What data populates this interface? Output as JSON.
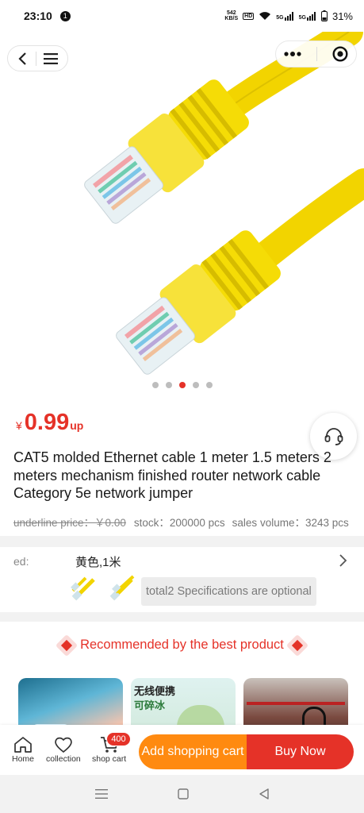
{
  "status_bar": {
    "time": "23:10",
    "notification_count": "1",
    "net_speed_top": "542",
    "net_speed_bottom": "KB/S",
    "hd_label": "HD",
    "signal1": "5G",
    "signal2": "5G",
    "battery": "31%"
  },
  "gallery": {
    "dot_count": 5,
    "active_dot": 3
  },
  "product": {
    "currency": "¥",
    "price": "0.99",
    "price_suffix": "up",
    "title": "CAT5 molded Ethernet cable 1 meter 1.5 meters 2 meters mechanism finished router network cable Category 5e network jumper",
    "underline_price": "underline price：￥0.00",
    "stock": "stock：200000 pcs",
    "sales": "sales volume：3243 pcs"
  },
  "spec": {
    "label": "ed:",
    "value": "黄色,1米",
    "optional_text": "total2 Specifications are optional"
  },
  "recommend": {
    "heading": "Recommended by the best product",
    "card2_text1": "无线便携",
    "card2_text2": "可碎冰"
  },
  "bottom_bar": {
    "home_label": "Home",
    "collection_label": "collection",
    "cart_label": "shop cart",
    "cart_badge": "400",
    "add_cart_label": "Add shopping cart",
    "buy_now_label": "Buy Now"
  },
  "colors": {
    "accent_red": "#e53228",
    "accent_orange": "#ff8a10",
    "cable_yellow": "#f2d400"
  },
  "icons": [
    "back-icon",
    "menu-icon",
    "more-icon",
    "target-icon",
    "customer-service-icon",
    "chevron-right-icon",
    "home-icon",
    "heart-icon",
    "cart-icon",
    "nav-menu-icon",
    "nav-home-icon",
    "nav-back-icon"
  ]
}
